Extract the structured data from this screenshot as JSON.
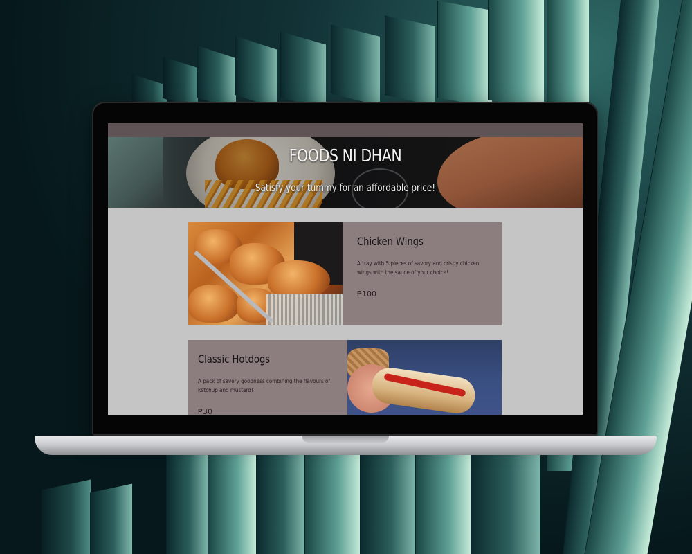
{
  "site": {
    "title": "FOODS NI DHAN",
    "tagline": "Satisfy your tummy for an affordable price!"
  },
  "menu": [
    {
      "name": "Chicken Wings",
      "description": "A tray with 5 pieces of savory and crispy chicken wings with the sauce of your choice!",
      "price": "₱100",
      "image": "chicken-wings-photo"
    },
    {
      "name": "Classic Hotdogs",
      "description": "A pack of savory goodness combining the flavours of ketchup and mustard!",
      "price": "₱30",
      "image": "hotdog-photo"
    }
  ],
  "colors": {
    "topbar": "#5f5355",
    "card": "#8c7d7e",
    "page": "#c6c5c6"
  }
}
